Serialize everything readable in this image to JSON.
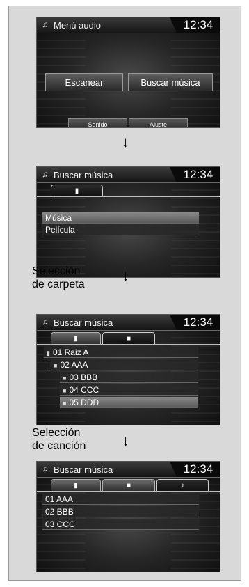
{
  "screen1": {
    "title_icon": "♫",
    "title": "Menú audio",
    "clock": "12:34",
    "buttons": [
      "Escanear",
      "Buscar música"
    ],
    "small_buttons": [
      "Sonido",
      "Ajuste"
    ]
  },
  "screen2": {
    "title_icon": "♫",
    "title": "Buscar música",
    "clock": "12:34",
    "tab_icon": "▮",
    "rows": [
      "Música",
      "Película"
    ]
  },
  "caption1": [
    "Selección",
    "de carpeta"
  ],
  "screen3": {
    "title_icon": "♫",
    "title": "Buscar música",
    "clock": "12:34",
    "tab_icons": [
      "▮",
      "■"
    ],
    "rows": [
      {
        "icon": "▮",
        "label": "01 Raiz A"
      },
      {
        "icon": "■",
        "label": "02 AAA"
      },
      {
        "icon": "■",
        "label": "03 BBB"
      },
      {
        "icon": "■",
        "label": "04 CCC"
      },
      {
        "icon": "■",
        "label": "05 DDD"
      }
    ]
  },
  "caption2": [
    "Selección",
    "de canción"
  ],
  "screen4": {
    "title_icon": "♫",
    "title": "Buscar música",
    "clock": "12:34",
    "tab_icons": [
      "▮",
      "■",
      "♪"
    ],
    "rows": [
      "01 AAA",
      "02 BBB",
      "03 CCC"
    ]
  },
  "arrow": "↓"
}
